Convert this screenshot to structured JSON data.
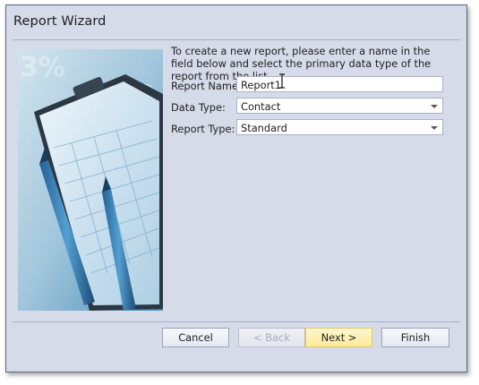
{
  "window": {
    "title": "Report Wizard"
  },
  "intro": "To create a new report, please enter a name in the field below and select the primary data type of the report from the list.",
  "form": {
    "report_name": {
      "label": "Report Name:",
      "value": "Report1"
    },
    "data_type": {
      "label": "Data Type:",
      "value": "Contact"
    },
    "report_type": {
      "label": "Report Type:",
      "value": "Standard"
    }
  },
  "buttons": {
    "cancel": "Cancel",
    "back": "< Back",
    "next": "Next >",
    "finish": "Finish"
  },
  "colors": {
    "dialog_bg": "#d6dbe9",
    "hot_button": "#fde99a",
    "border": "#5b6780"
  }
}
